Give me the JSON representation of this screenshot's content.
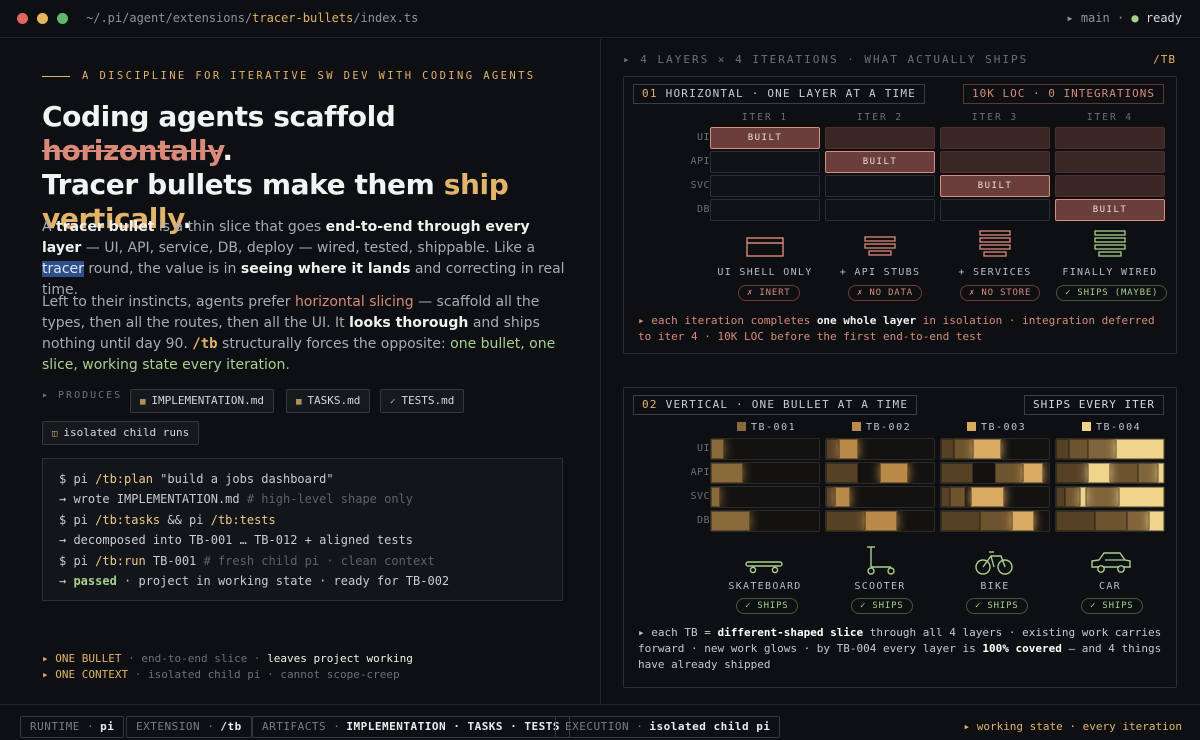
{
  "titlebar": {
    "path_prefix": "~/.pi/agent/extensions/",
    "path_highlight": "tracer-bullets",
    "path_suffix": "/index.ts",
    "branch": "▸ main ·",
    "state_dot": "●",
    "state": "ready",
    "colors": {
      "close": "#e0665e",
      "minimize": "#e6b65a",
      "maximize": "#5fb96a"
    }
  },
  "left": {
    "kicker": "A DISCIPLINE FOR ITERATIVE SW DEV WITH CODING AGENTS",
    "headline": {
      "l1a": "Coding agents scaffold ",
      "l1b": "horizontally",
      "l1c": ".",
      "l2a": "Tracer bullets make them ",
      "l2b": "ship",
      "l3a": "vertically",
      "l3b": "."
    },
    "p1": {
      "t1": "A ",
      "t2": "tracer bullet",
      "t3": " is a thin slice that goes ",
      "t4": "end-to-end through every layer",
      "t5": " — UI, API, service, DB, deploy — wired, tested, shippable. Like a ",
      "t6": "tracer",
      "t7": " round, the value is in ",
      "t8": "seeing where it lands",
      "t9": " and correcting in real time."
    },
    "p2": {
      "t1": "Left to their instincts, agents prefer ",
      "t2": "horizontal slicing",
      "t3": " — scaffold all the types, then all the routes, then all the UI. It ",
      "t4": "looks thorough",
      "t5": " and ships nothing until day 90. ",
      "t6": "/tb",
      "t7": " structurally forces the opposite: ",
      "t8": "one bullet, one slice, working state every iteration",
      "t9": "."
    },
    "produces_label": "▸ PRODUCES",
    "chips": [
      {
        "glyph": "▦",
        "label": "IMPLEMENTATION.md"
      },
      {
        "glyph": "▦",
        "label": "TASKS.md"
      },
      {
        "glyph": "✓",
        "label": "TESTS.md"
      },
      {
        "glyph": "◫",
        "label": "isolated child runs"
      }
    ],
    "terminal": [
      {
        "a": "$ pi ",
        "b": "/tb:plan",
        "c": " \"build a jobs dashboard\"",
        "d": ""
      },
      {
        "a": "→ wrote IMPLEMENTATION.md ",
        "b": "",
        "c": "",
        "d": "# high-level shape only"
      },
      {
        "a": "$ pi ",
        "b": "/tb:tasks",
        "c": " && pi ",
        "e": "/tb:tests"
      },
      {
        "a": "→ decomposed into TB-001 … TB-012 + aligned tests"
      },
      {
        "a": "$ pi ",
        "b": "/tb:run",
        "c": " TB-001 ",
        "d": "# fresh child pi · clean context"
      },
      {
        "a": "→ ",
        "g": "passed",
        "c": " · project in working state · ready for TB-002"
      }
    ],
    "bullets": [
      {
        "k": "▸ ONE BULLET",
        "m": " · end-to-end slice · ",
        "v": "leaves project working"
      },
      {
        "k": "▸ ONE CONTEXT",
        "m": " · isolated child pi · cannot scope-creep",
        "v": ""
      }
    ]
  },
  "right": {
    "kicker": "▸ 4 LAYERS × 4 ITERATIONS · WHAT ACTUALLY SHIPS",
    "tb": "/TB",
    "layers": [
      "UI",
      "API",
      "SVC",
      "DB"
    ],
    "iterations": [
      "ITER 1",
      "ITER 2",
      "ITER 3",
      "ITER 4"
    ],
    "horizontal": {
      "num": "01",
      "title": "HORIZONTAL · ONE LAYER AT A TIME",
      "stat": "10K LOC · 0 INTEGRATIONS",
      "built_label": "BUILT",
      "captions": [
        "UI SHELL ONLY",
        "+ API STUBS",
        "+ SERVICES",
        "FINALLY WIRED"
      ],
      "pills": [
        "✗ INERT",
        "✗ NO DATA",
        "✗ NO STORE",
        "✓ SHIPS (MAYBE)"
      ],
      "pill_ok": [
        false,
        false,
        false,
        true
      ],
      "icons": [
        "ui-shell-icon",
        "api-stack-icon",
        "services-stack-icon",
        "wired-stack-icon"
      ],
      "note": {
        "a": "▸ each iteration completes ",
        "b": "one whole layer",
        "c": " in isolation · integration deferred to iter 4 · 10K LOC before the first end-to-end test"
      }
    },
    "vertical": {
      "num": "02",
      "title": "VERTICAL · ONE BULLET AT A TIME",
      "stat": "SHIPS EVERY ITER",
      "tbs": [
        "TB-001",
        "TB-002",
        "TB-003",
        "TB-004"
      ],
      "tb_colors": [
        "#8a6a3a",
        "#b98a48",
        "#d9aa62",
        "#f0d48c"
      ],
      "captions": [
        "SKATEBOARD",
        "SCOOTER",
        "BIKE",
        "CAR"
      ],
      "icons": [
        "skateboard-icon",
        "scooter-icon",
        "bike-icon",
        "car-icon"
      ],
      "pill": "✓ SHIPS",
      "note": {
        "a": "▸ each TB = ",
        "b": "different-shaped slice",
        "c": " through all 4 layers · existing work carries forward · new work glows · by TB-004 every layer is ",
        "d": "100% covered",
        "e": " — and 4 things have already shipped"
      }
    }
  },
  "footer": {
    "chips": [
      {
        "k": "RUNTIME ·",
        "v": "pi"
      },
      {
        "k": "EXTENSION ·",
        "v": "/tb"
      },
      {
        "k": "ARTIFACTS ·",
        "v": "IMPLEMENTATION · TASKS · TESTS"
      },
      {
        "k": "EXECUTION ·",
        "v": "isolated child pi"
      }
    ],
    "right": "▸ working state · every iteration"
  }
}
